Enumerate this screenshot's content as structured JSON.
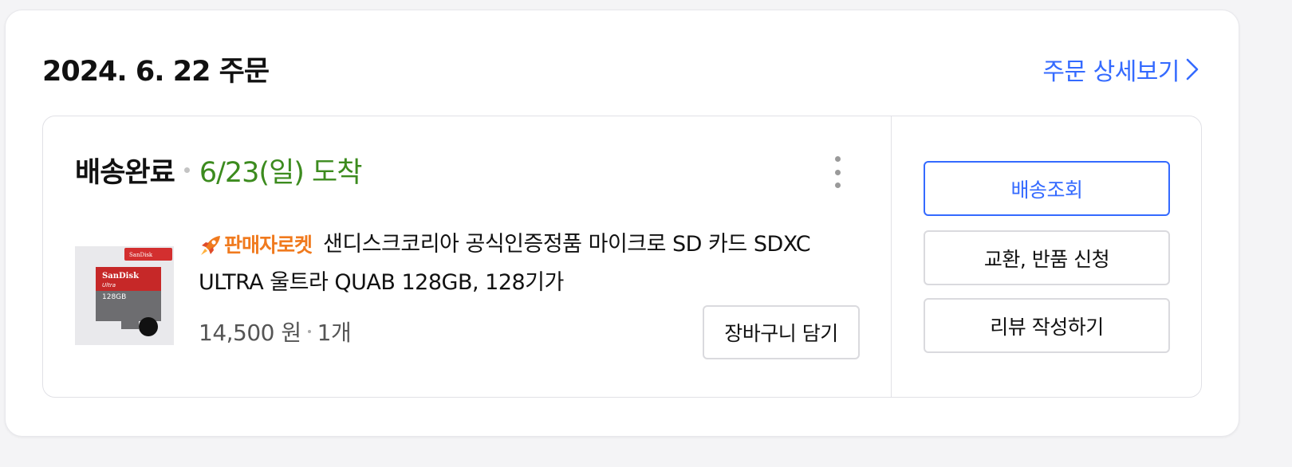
{
  "order": {
    "date_title": "2024. 6. 22 주문",
    "detail_link": "주문 상세보기"
  },
  "shipment": {
    "status": "배송완료",
    "arrival": "6/23(일) 도착"
  },
  "product": {
    "badge_label": "판매자로켓",
    "title": "샌디스크코리아 공식인증정품 마이크로 SD 카드 SDXC ULTRA 울트라 QUAB 128GB, 128기가",
    "price": "14,500 원",
    "quantity": "1개",
    "cart_button": "장바구니 담기",
    "thumbnail": {
      "store_badge": "SanDisk",
      "brand": "SanDisk",
      "line": "Ultra",
      "capacity": "128GB"
    }
  },
  "actions": {
    "track": "배송조회",
    "exchange_return": "교환, 반품 신청",
    "write_review": "리뷰 작성하기"
  },
  "colors": {
    "accent": "#346aff",
    "arrival_green": "#3c8b1e",
    "rocket_orange": "#f07a1e"
  }
}
